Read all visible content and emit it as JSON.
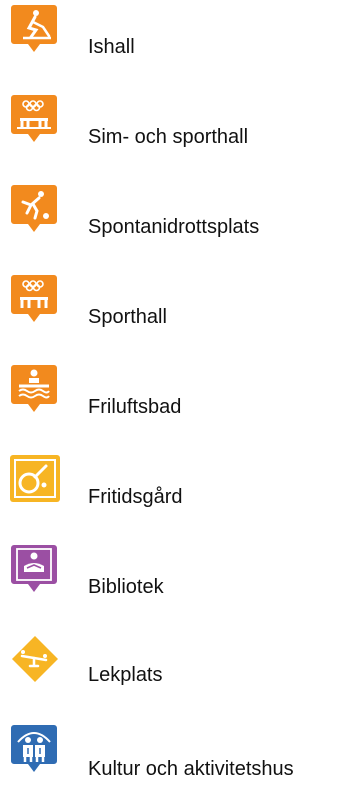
{
  "legend": {
    "items": [
      {
        "label": "Ishall",
        "icon": "ice-rink-icon"
      },
      {
        "label": "Sim- och sporthall",
        "icon": "swim-sports-hall-icon"
      },
      {
        "label": "Spontanidrottsplats",
        "icon": "spontaneous-sports-field-icon"
      },
      {
        "label": "Sporthall",
        "icon": "sports-hall-icon"
      },
      {
        "label": "Friluftsbad",
        "icon": "outdoor-bath-icon"
      },
      {
        "label": "Fritidsgård",
        "icon": "youth-center-icon"
      },
      {
        "label": "Bibliotek",
        "icon": "library-icon"
      },
      {
        "label": "Lekplats",
        "icon": "playground-icon"
      },
      {
        "label": "Kultur och aktivitetshus",
        "icon": "culture-activity-house-icon"
      }
    ]
  },
  "colors": {
    "orange": "#f28a1e",
    "yellow": "#f7b524",
    "purple": "#9b4fa3",
    "blue": "#2f6cb3",
    "text": "#111111"
  }
}
